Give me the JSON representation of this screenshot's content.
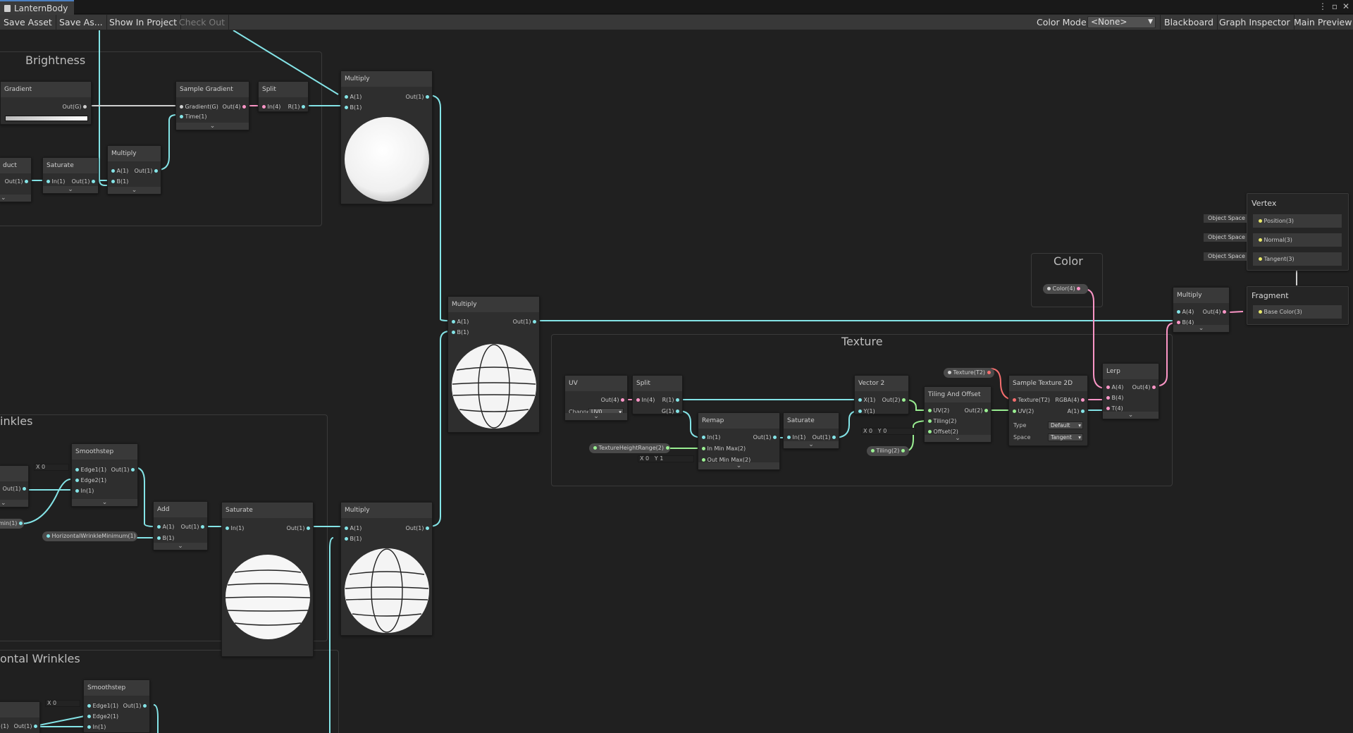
{
  "window": {
    "tab_title": "LanternBody",
    "menu_icon": "kebab-menu-icon",
    "maximize_icon": "maximize-icon",
    "close_icon": "close-icon"
  },
  "toolbar": {
    "save_asset": "Save Asset",
    "save_as": "Save As...",
    "show_in_project": "Show In Project",
    "check_out": "Check Out",
    "color_mode_label": "Color Mode",
    "color_mode_value": "<None>",
    "blackboard": "Blackboard",
    "graph_inspector": "Graph Inspector",
    "main_preview": "Main Preview"
  },
  "groups": {
    "brightness": "Brightness",
    "wrinkles": "inkles",
    "horizontal_wrinkles": "ontal Wrinkles",
    "texture": "Texture",
    "color": "Color"
  },
  "nodes": {
    "gradient": {
      "title": "Gradient",
      "out": "Out(G)"
    },
    "sample_gradient": {
      "title": "Sample Gradient",
      "in1": "Gradient(G)",
      "in2": "Time(1)",
      "out": "Out(4)"
    },
    "split_top": {
      "title": "Split",
      "in": "In(4)",
      "out": "R(1)"
    },
    "multiply_top": {
      "title": "Multiply",
      "a": "A(1)",
      "b": "B(1)",
      "out": "Out(1)"
    },
    "dot_product": {
      "title": "duct",
      "out": "Out(1)"
    },
    "saturate_top": {
      "title": "Saturate",
      "in": "In(1)",
      "out": "Out(1)"
    },
    "multiply_small": {
      "title": "Multiply",
      "a": "A(1)",
      "b": "B(1)",
      "out": "Out(1)"
    },
    "multiply_mid": {
      "title": "Multiply",
      "a": "A(1)",
      "b": "B(1)",
      "out": "Out(1)"
    },
    "smoothstep1": {
      "title": "Smoothstep",
      "e1": "Edge1(1)",
      "e2": "Edge2(1)",
      "in": "In(1)",
      "out": "Out(1)",
      "x": "X",
      "x_val": "0"
    },
    "left_w": {
      "out": "Out(1)"
    },
    "add": {
      "title": "Add",
      "a": "A(1)",
      "b": "B(1)",
      "out": "Out(1)"
    },
    "saturate_w": {
      "title": "Saturate",
      "in": "In(1)",
      "out": "Out(1)"
    },
    "multiply_bottom": {
      "title": "Multiply",
      "a": "A(1)",
      "b": "B(1)",
      "out": "Out(1)"
    },
    "smoothstep2": {
      "title": "Smoothstep",
      "e1": "Edge1(1)",
      "e2": "Edge2(1)",
      "in": "In(1)",
      "out": "Out(1)",
      "x": "X",
      "x_val": "0"
    },
    "left_h": {
      "in": "(1)",
      "out": "Out(1)"
    },
    "uv": {
      "title": "UV",
      "out": "Out(4)",
      "channel_label": "Channel",
      "channel_value": "UV0"
    },
    "split_tex": {
      "title": "Split",
      "in": "In(4)",
      "r": "R(1)",
      "g": "G(1)"
    },
    "remap": {
      "title": "Remap",
      "in": "In(1)",
      "inmm": "In Min Max(2)",
      "outmm": "Out Min Max(2)",
      "out": "Out(1)",
      "x": "X",
      "x_val": "0",
      "y": "Y",
      "y_val": "1"
    },
    "saturate_tex": {
      "title": "Saturate",
      "in": "In(1)",
      "out": "Out(1)"
    },
    "vector2": {
      "title": "Vector 2",
      "x": "X(1)",
      "y": "Y(1)",
      "out": "Out(2)",
      "xl": "X",
      "x_val": "0",
      "yl": "Y",
      "y_val": "0"
    },
    "tiling_offset": {
      "title": "Tiling And Offset",
      "uv": "UV(2)",
      "tiling": "Tiling(2)",
      "offset": "Offset(2)",
      "out": "Out(2)"
    },
    "sample_tex": {
      "title": "Sample Texture 2D",
      "tex": "Texture(T2)",
      "uv": "UV(2)",
      "rgba": "RGBA(4)",
      "a": "A(1)",
      "type_label": "Type",
      "type_value": "Default",
      "space_label": "Space",
      "space_value": "Tangent"
    },
    "lerp": {
      "title": "Lerp",
      "a": "A(4)",
      "b": "B(4)",
      "t": "T(4)",
      "out": "Out(4)"
    },
    "multiply_final": {
      "title": "Multiply",
      "a": "A(4)",
      "b": "B(4)",
      "out": "Out(4)"
    },
    "vertex": {
      "title": "Vertex",
      "pos": "Position(3)",
      "norm": "Normal(3)",
      "tan": "Tangent(3)",
      "space": "Object Space"
    },
    "fragment": {
      "title": "Fragment",
      "base": "Base Color(3)"
    }
  },
  "properties": {
    "texture_height_range": "TextureHeightRange(2)",
    "horizontal_wrinkle_min": "HorizontalWrinkleMinimum(1)",
    "texture": "Texture(T2)",
    "tiling": "Tiling(2)",
    "color": "Color(4)",
    "left_pill": "min(1)"
  },
  "colors": {
    "float": "#84e4e7",
    "vector4": "#fb95c6",
    "vector2": "#9aef92",
    "vector3": "#e8e86a",
    "texture": "#f46e6e"
  }
}
